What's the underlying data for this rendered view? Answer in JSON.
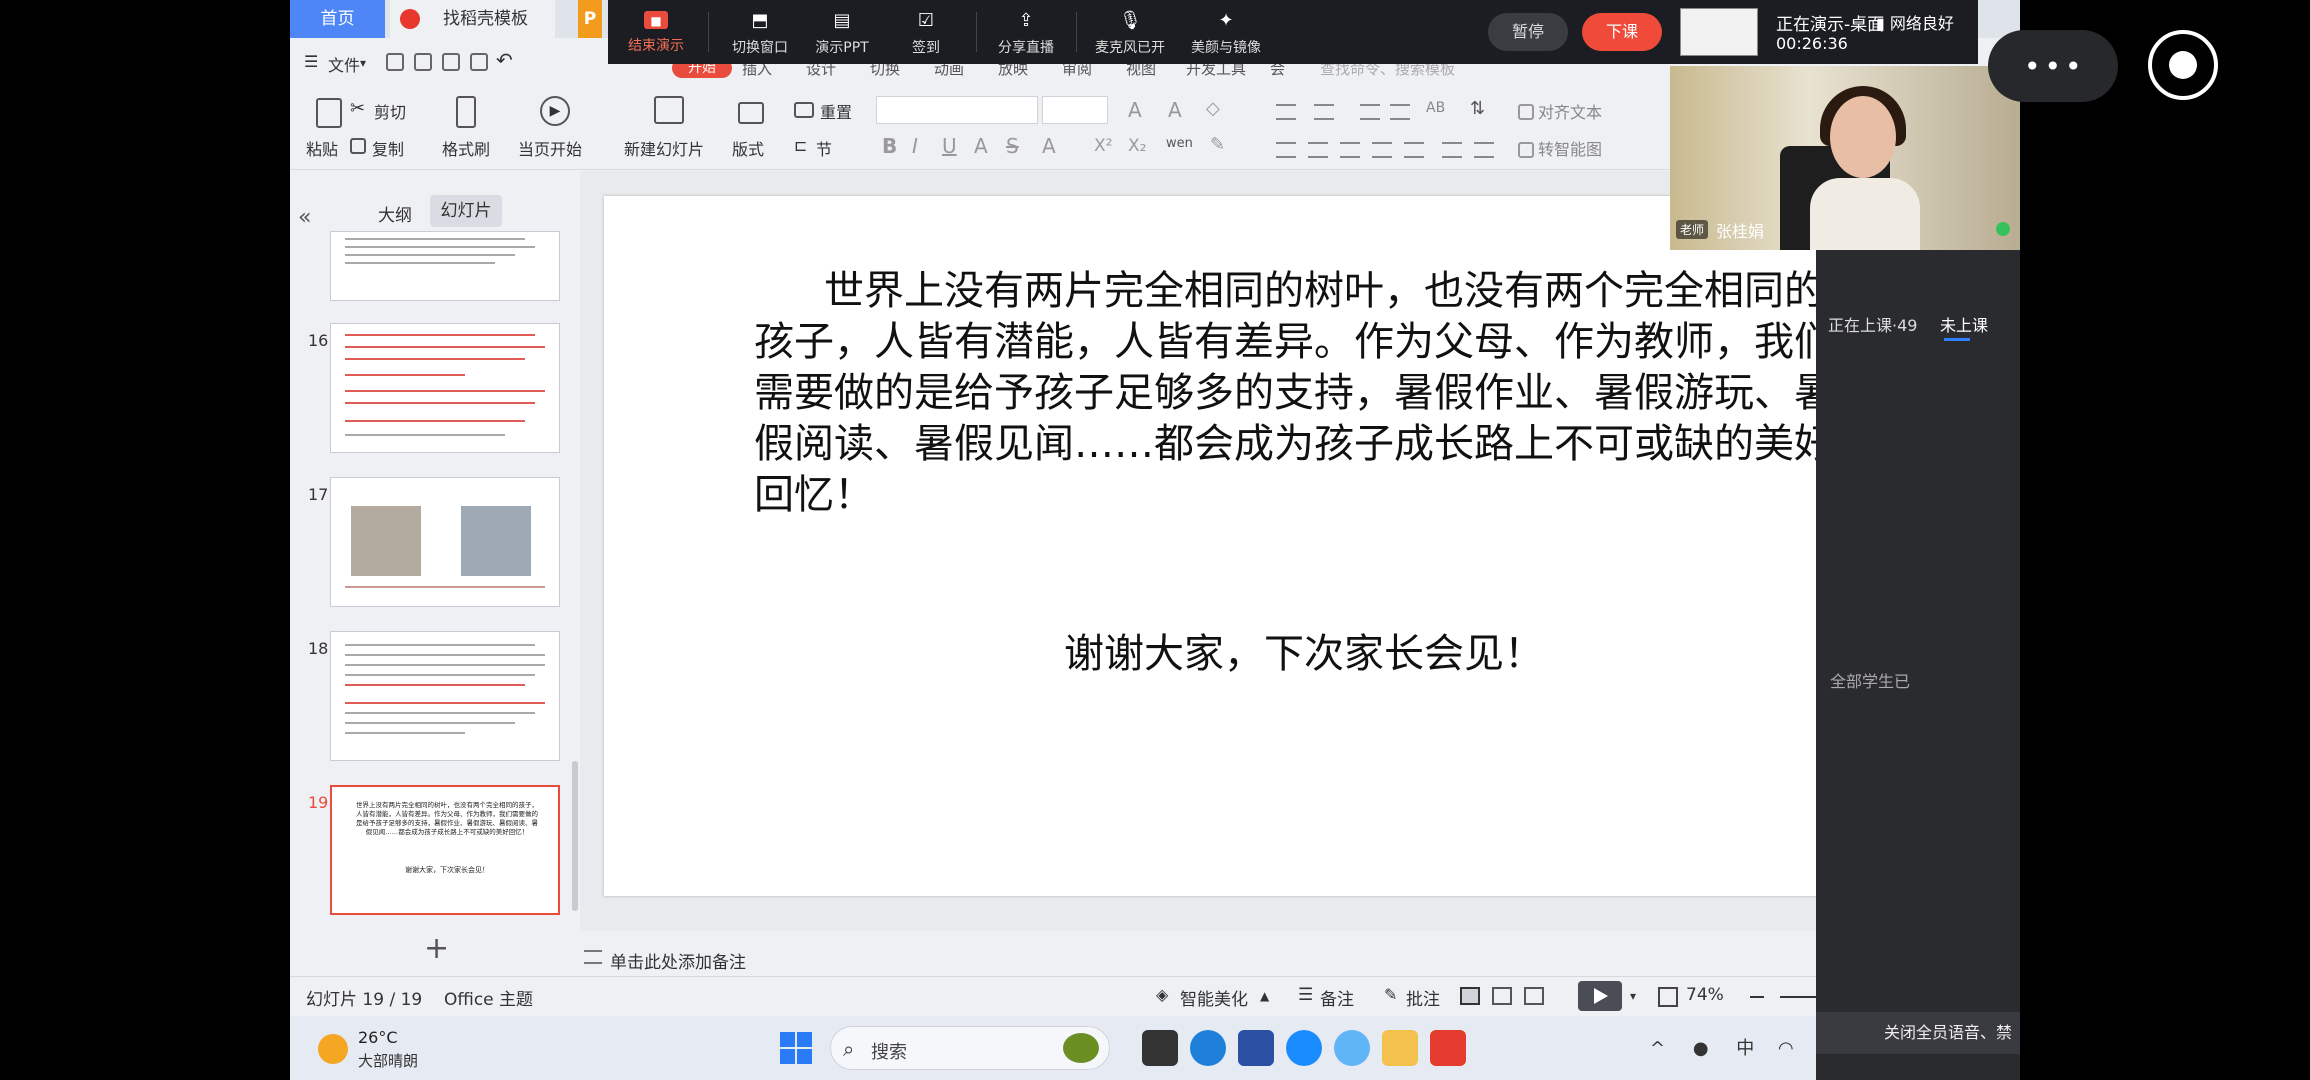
{
  "wps_tabs": {
    "home": "首页",
    "template": "找稻壳模板",
    "ppt": "P"
  },
  "presenter_bar": {
    "end_show": "结束演示",
    "switch_window": "切换窗口",
    "present_ppt": "演示PPT",
    "check_in": "签到",
    "share_live": "分享直播",
    "mic_on": "麦克风已开",
    "beauty": "美颜与镜像",
    "pause": "暂停",
    "leave": "下课",
    "status_title": "正在演示-桌面",
    "status_time": "00:26:36",
    "network": "网络良好"
  },
  "menu": {
    "file": "文件",
    "start": "开始",
    "insert": "插入",
    "design": "设计",
    "switch": "切换",
    "animation": "动画",
    "show": "放映",
    "review": "审阅",
    "view": "视图",
    "dev": "开发工具",
    "member": "会",
    "search_placeholder": "查找命令、搜索模板"
  },
  "ribbon": {
    "paste": "粘贴",
    "cut": "剪切",
    "copy": "复制",
    "format_painter": "格式刷",
    "from_current": "当页开始",
    "new_slide": "新建幻灯片",
    "layout": "版式",
    "reset": "重置",
    "section": "节",
    "align_text": "对齐文本",
    "convert_smartart": "转智能图",
    "bold": "B",
    "italic": "I",
    "underline": "U",
    "strike": "A",
    "strike2": "S",
    "sup": "X²",
    "sub": "X₂",
    "pinyin": "wen"
  },
  "left_panel": {
    "outline_tab": "大纲",
    "slides_tab": "幻灯片",
    "slide_numbers": [
      "16",
      "17",
      "18",
      "19"
    ]
  },
  "slide": {
    "body": "世界上没有两片完全相同的树叶，也没有两个完全相同的孩子，人皆有潜能，人皆有差异。作为父母、作为教师，我们需要做的是给予孩子足够多的支持，暑假作业、暑假游玩、暑假阅读、暑假见闻……都会成为孩子成长路上不可或缺的美好回忆！",
    "closing": "谢谢大家，下次家长会见！"
  },
  "thumb19": {
    "body": "世界上没有两片完全相同的树叶，也没有两个完全相同的孩子，人皆有潜能，人皆有差异。作为父母、作为教师，我们需要做的是给予孩子足够多的支持，暑假作业、暑假游玩、暑假阅读、暑假见闻……都会成为孩子成长路上不可或缺的美好回忆！",
    "closing": "谢谢大家，下次家长会见！"
  },
  "notes_placeholder": "单击此处添加备注",
  "status_bar": {
    "slide_count": "幻灯片 19 / 19",
    "theme": "Office 主题",
    "beautify": "智能美化",
    "notes": "备注",
    "comment": "批注",
    "zoom": "74%"
  },
  "taskbar": {
    "temp": "26°C",
    "weather": "大部晴朗",
    "search": "搜索",
    "ime": "中"
  },
  "right_panel": {
    "teacher_tag": "老师",
    "teacher_name": "张桂娟",
    "tab_live": "正在上课·49",
    "tab_absent": "未上课",
    "all_students": "全部学生已",
    "mute_all": "关闭全员语音、禁"
  },
  "colors": {
    "accent": "#e94b3c",
    "wps_blue": "#4f86f7",
    "presenter_bg": "#1b1d22"
  }
}
